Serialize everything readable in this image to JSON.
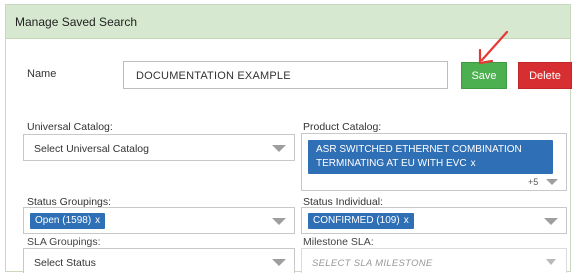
{
  "dialog": {
    "title": "Manage Saved Search"
  },
  "name": {
    "label": "Name",
    "value": "DOCUMENTATION EXAMPLE"
  },
  "buttons": {
    "save": "Save",
    "delete": "Delete"
  },
  "universal_catalog": {
    "label": "Universal Catalog:",
    "value": "Select Universal Catalog"
  },
  "product_catalog": {
    "label": "Product Catalog:",
    "chip": "ASR SWITCHED ETHERNET COMBINATION TERMINATING AT EU WITH EVC",
    "chip_remove": "x",
    "more": "+5"
  },
  "status_groupings": {
    "label": "Status Groupings:",
    "chip": "Open (1598)",
    "chip_remove": "x"
  },
  "status_individual": {
    "label": "Status Individual:",
    "chip": "CONFIRMED (109)",
    "chip_remove": "x"
  },
  "sla_groupings": {
    "label": "SLA Groupings:",
    "value": "Select Status"
  },
  "milestone_sla": {
    "label": "Milestone SLA:",
    "placeholder": "SELECT SLA MILESTONE"
  },
  "colors": {
    "header_bg": "#d6e8cf",
    "save": "#4caf50",
    "delete": "#d72f31",
    "chip": "#2f6fb5",
    "annotation_arrow": "#e53935"
  },
  "icons": {
    "dropdown": "chevron-down-icon",
    "annotation": "arrow-annotation-icon"
  }
}
